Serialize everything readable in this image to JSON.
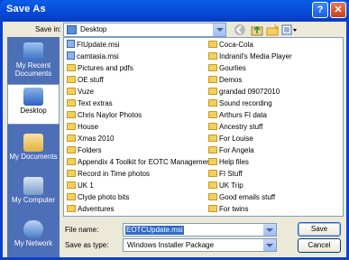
{
  "window": {
    "title": "Save As",
    "help_glyph": "?",
    "close_glyph": "✕"
  },
  "save_in": {
    "label": "Save in:",
    "value": "Desktop"
  },
  "places": [
    {
      "name": "my-recent-documents",
      "label": "My Recent Documents"
    },
    {
      "name": "desktop",
      "label": "Desktop"
    },
    {
      "name": "my-documents",
      "label": "My Documents"
    },
    {
      "name": "my-computer",
      "label": "My Computer"
    },
    {
      "name": "my-network",
      "label": "My Network"
    }
  ],
  "files_left": [
    {
      "kind": "msi",
      "label": "FIUpdate.msi"
    },
    {
      "kind": "msi",
      "label": "camtasia.msi"
    },
    {
      "kind": "folder",
      "label": "Pictures and pdfs"
    },
    {
      "kind": "folder",
      "label": "OE stuff"
    },
    {
      "kind": "folder",
      "label": "Vuze"
    },
    {
      "kind": "folder",
      "label": "Text extras"
    },
    {
      "kind": "folder",
      "label": "Chris Naylor Photos"
    },
    {
      "kind": "folder",
      "label": "House"
    },
    {
      "kind": "folder",
      "label": "Xmas 2010"
    },
    {
      "kind": "folder",
      "label": "Folders"
    },
    {
      "kind": "folder",
      "label": "Appendix 4 Toolkit for EOTC Management"
    },
    {
      "kind": "folder",
      "label": "Record in Time photos"
    },
    {
      "kind": "folder",
      "label": "UK 1"
    },
    {
      "kind": "folder",
      "label": "Clyde photo bits"
    },
    {
      "kind": "folder",
      "label": "Adventures"
    }
  ],
  "files_right": [
    {
      "kind": "folder",
      "label": "Coca-Cola"
    },
    {
      "kind": "folder",
      "label": "Indranil's Media Player"
    },
    {
      "kind": "folder",
      "label": "Gourlies"
    },
    {
      "kind": "folder",
      "label": "Demos"
    },
    {
      "kind": "folder",
      "label": "grandad 09072010"
    },
    {
      "kind": "folder",
      "label": "Sound recording"
    },
    {
      "kind": "folder",
      "label": "Arthurs FI data"
    },
    {
      "kind": "folder",
      "label": "Ancestry stuff"
    },
    {
      "kind": "folder",
      "label": "For Louise"
    },
    {
      "kind": "folder",
      "label": "For Angela"
    },
    {
      "kind": "folder",
      "label": "Help files"
    },
    {
      "kind": "folder",
      "label": "FI Stuff"
    },
    {
      "kind": "folder",
      "label": "UK Trip"
    },
    {
      "kind": "folder",
      "label": "Good emails stuff"
    },
    {
      "kind": "folder",
      "label": "For twins"
    }
  ],
  "file_name": {
    "label": "File name:",
    "value": "EOTCUpdate.msi"
  },
  "save_as_type": {
    "label": "Save as type:",
    "value": "Windows Installer Package"
  },
  "buttons": {
    "save": "Save",
    "cancel": "Cancel"
  },
  "colors": {
    "title_bar": "#0a5ee8",
    "places_bar": "#4d6fb8",
    "selection": "#316ac5"
  }
}
